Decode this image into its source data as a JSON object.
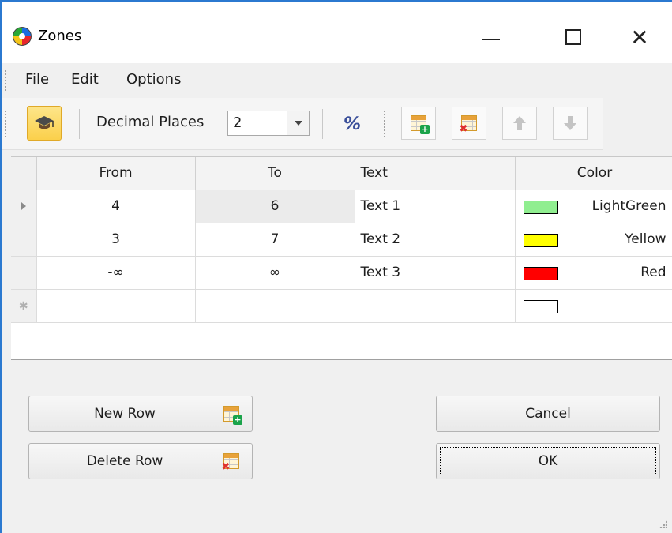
{
  "window": {
    "title": "Zones"
  },
  "menu": {
    "items": [
      "File",
      "Edit",
      "Options"
    ]
  },
  "toolbar": {
    "decimal_label": "Decimal Places",
    "decimal_value": "2",
    "percent_symbol": "%"
  },
  "grid": {
    "columns": [
      "From",
      "To",
      "Text",
      "Color"
    ],
    "rows": [
      {
        "from": "4",
        "to": "6",
        "text": "Text 1",
        "color_name": "LightGreen",
        "swatch": "#90ee90"
      },
      {
        "from": "3",
        "to": "7",
        "text": "Text 2",
        "color_name": "Yellow",
        "swatch": "#ffff00"
      },
      {
        "from": "-∞",
        "to": "∞",
        "text": "Text 3",
        "color_name": "Red",
        "swatch": "#ff0000"
      }
    ],
    "new_row": {
      "swatch": "#ffffff"
    }
  },
  "buttons": {
    "new_row": "New Row",
    "delete_row": "Delete Row",
    "cancel": "Cancel",
    "ok": "OK"
  },
  "icons": {
    "app": "zones-app-icon",
    "help": "graduation-cap-icon",
    "percent": "percent-icon",
    "add_row": "add-row-icon",
    "delete_row": "delete-row-icon",
    "move_up": "arrow-up-icon",
    "move_down": "arrow-down-icon"
  },
  "colors": {
    "title_border": "#2b79d0",
    "help_button": "#fbd04b"
  }
}
